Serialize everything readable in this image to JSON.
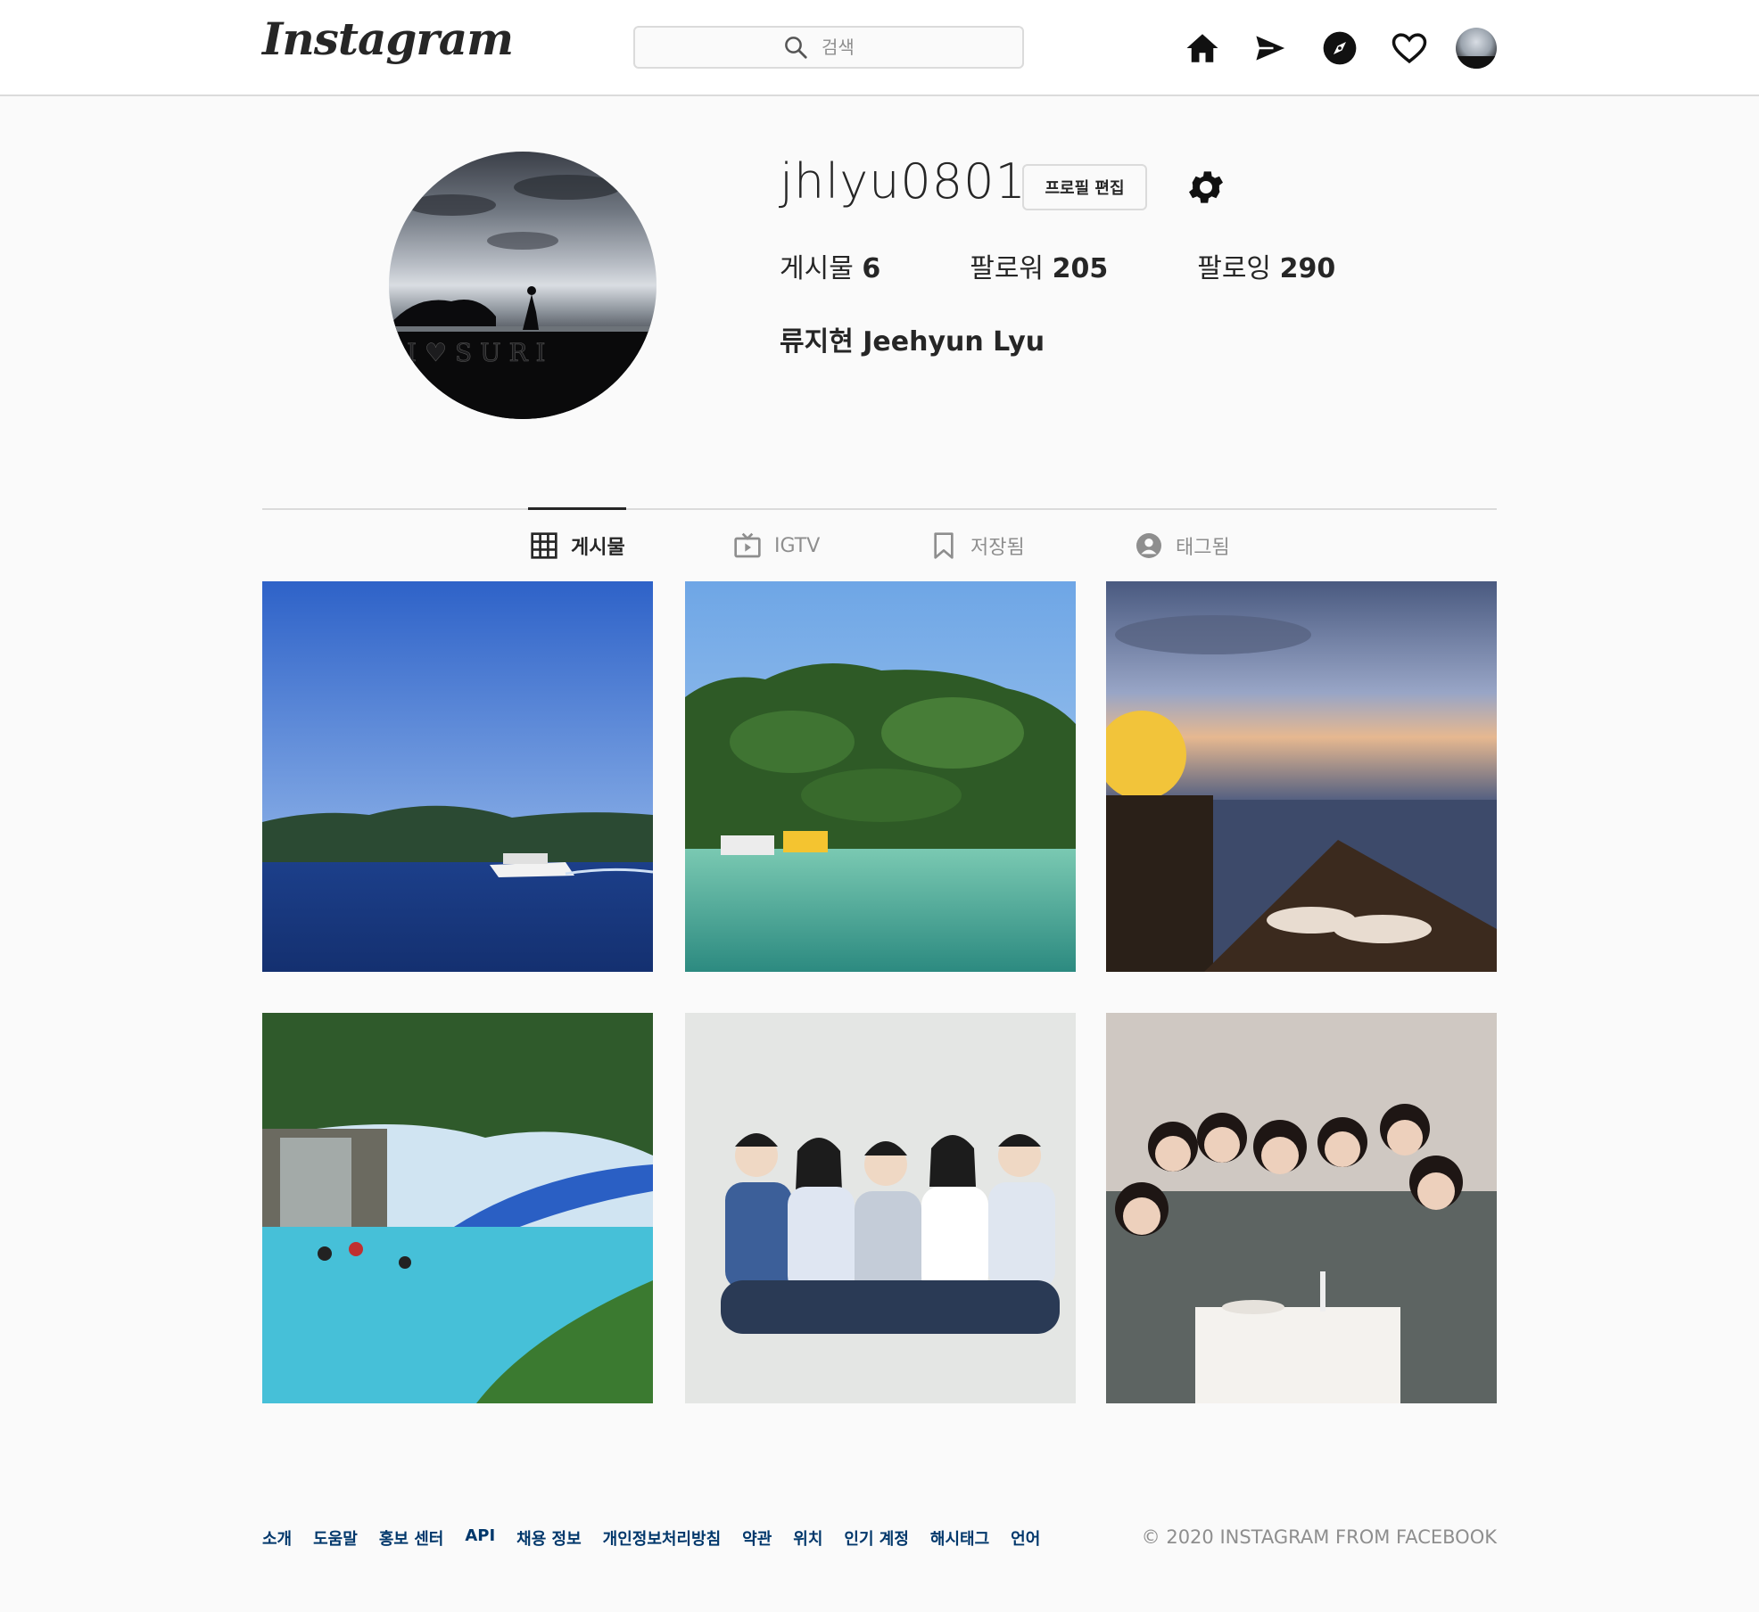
{
  "header": {
    "logo": "Instagram",
    "search_placeholder": "검색",
    "icons": [
      "home-icon",
      "direct-icon",
      "explore-icon",
      "activity-icon"
    ]
  },
  "profile": {
    "username": "jhlyu0801",
    "edit_button": "프로필 편집",
    "stats": [
      {
        "label": "게시물",
        "value": "6"
      },
      {
        "label": "팔로워",
        "value": "205"
      },
      {
        "label": "팔로잉",
        "value": "290"
      }
    ],
    "full_name": "류지현 Jeehyun Lyu"
  },
  "tabs": [
    {
      "label": "게시물",
      "icon": "grid-icon",
      "active": true
    },
    {
      "label": "IGTV",
      "icon": "tv-icon",
      "active": false
    },
    {
      "label": "저장됨",
      "icon": "bookmark-icon",
      "active": false
    },
    {
      "label": "태그됨",
      "icon": "user-tag-icon",
      "active": false
    }
  ],
  "posts": [
    "boat-sea",
    "island-boats",
    "sunset-dinner",
    "pool-resort",
    "family-photo",
    "friends-party"
  ],
  "footer": {
    "links": [
      "소개",
      "도움말",
      "홍보 센터",
      "API",
      "채용 정보",
      "개인정보처리방침",
      "약관",
      "위치",
      "인기 계정",
      "해시태그",
      "언어"
    ],
    "copyright": "© 2020 INSTAGRAM FROM FACEBOOK"
  },
  "colors": {
    "border": "#dbdbdb",
    "text": "#262626",
    "muted": "#8e8e8e",
    "link": "#00376b"
  }
}
